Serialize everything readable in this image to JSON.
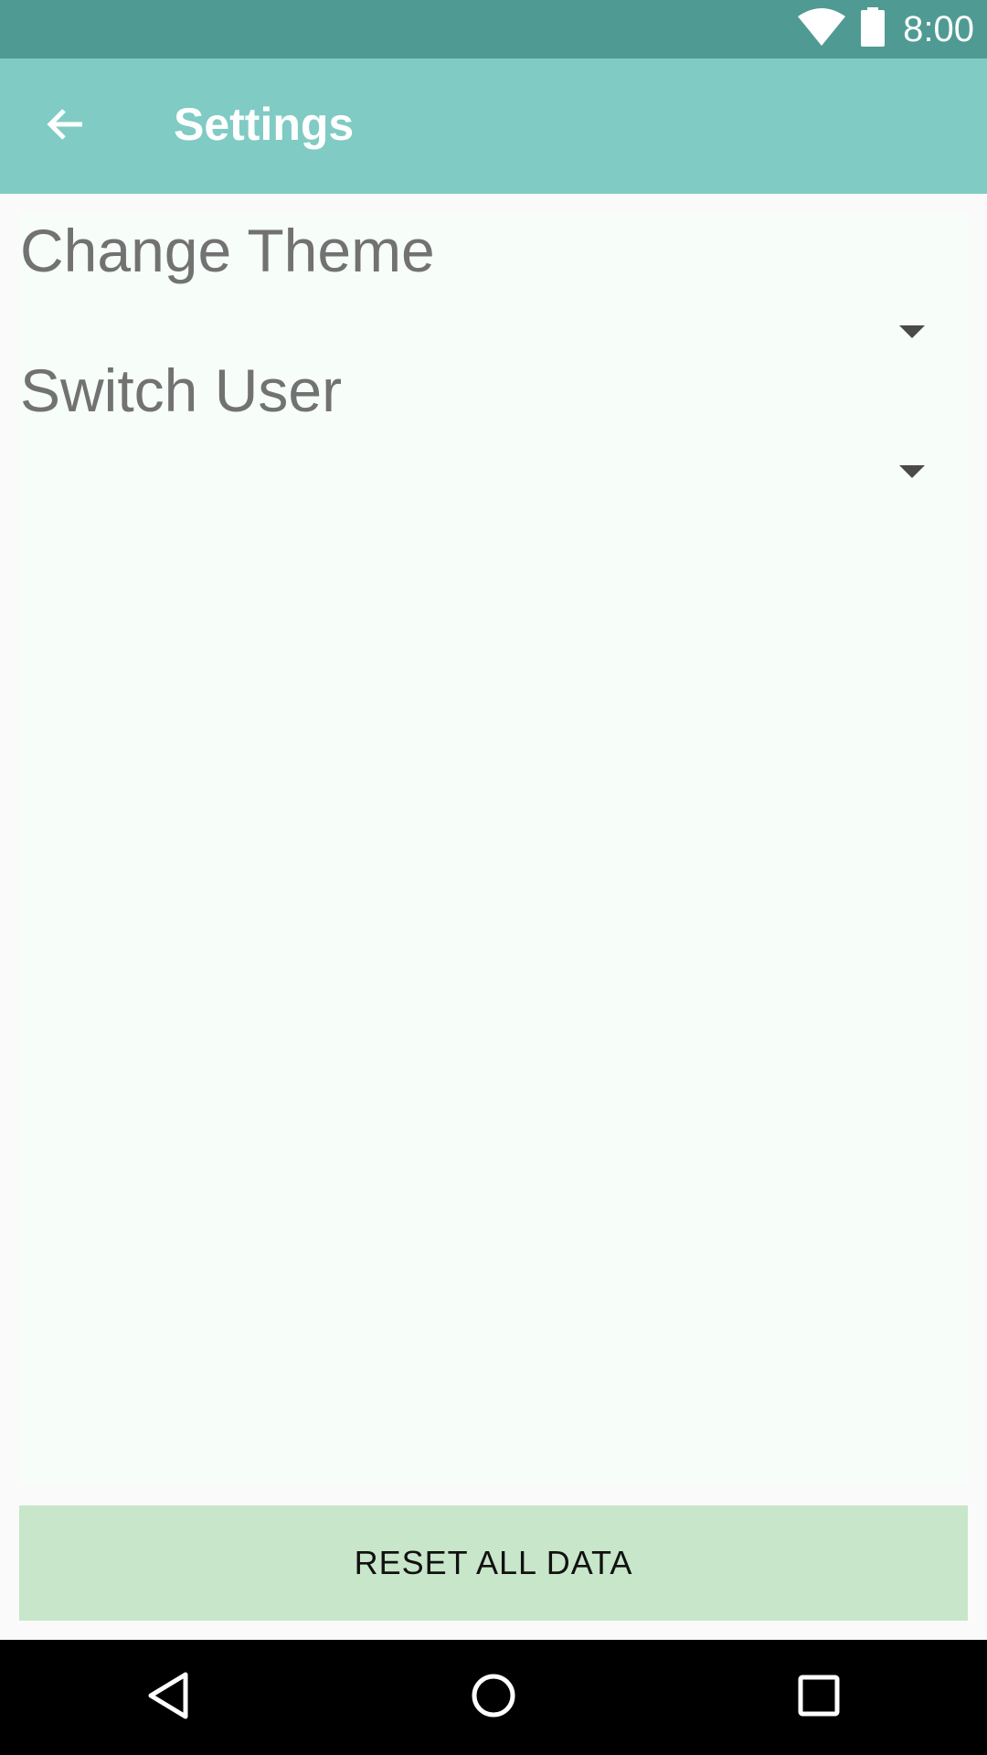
{
  "status_bar": {
    "time": "8:00",
    "icons": [
      "wifi-icon",
      "battery-icon"
    ],
    "background": "#4f9b94"
  },
  "app_bar": {
    "title": "Settings",
    "back_icon": "back-arrow-icon",
    "background": "#80cbc4"
  },
  "settings": {
    "items": [
      {
        "label": "Change Theme",
        "value": ""
      },
      {
        "label": "Switch User",
        "value": ""
      }
    ]
  },
  "reset_button": {
    "label": "RESET ALL DATA",
    "background": "#c8e6c9"
  },
  "nav_bar": {
    "buttons": [
      "nav-back-icon",
      "nav-home-icon",
      "nav-recents-icon"
    ]
  }
}
